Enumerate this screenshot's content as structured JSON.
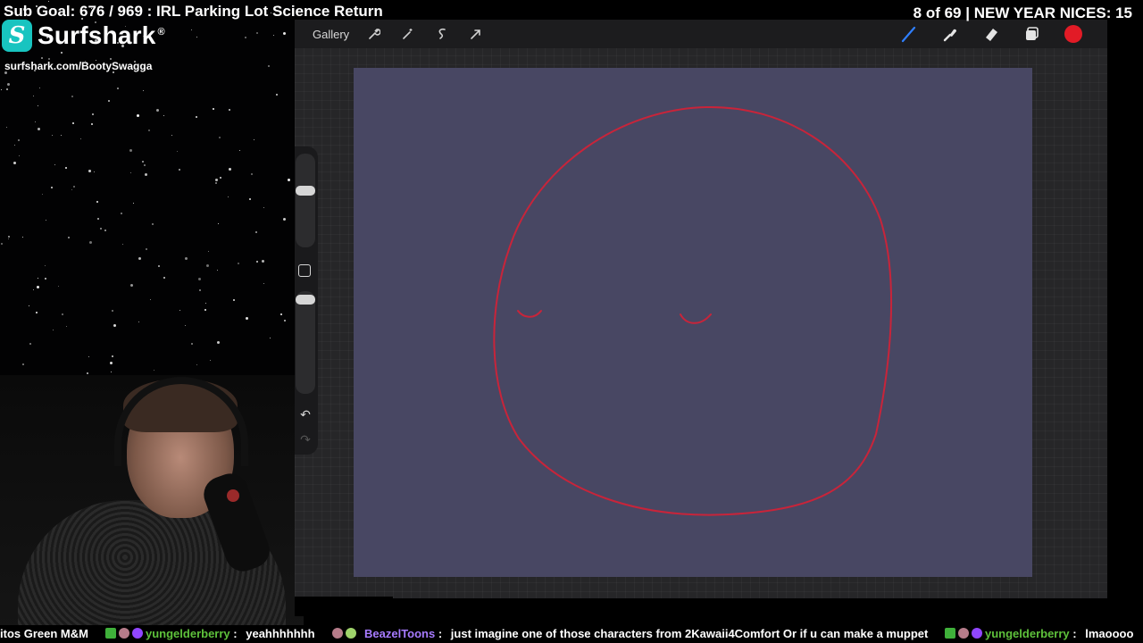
{
  "overlay": {
    "sub_goal": "Sub Goal: 676 / 969 : IRL Parking Lot Science Return",
    "counter": "8 of 69 | NEW YEAR NICES: 15"
  },
  "sponsor": {
    "logo_letter": "S",
    "name": "Surfshark",
    "reg_mark": "®",
    "url": "surfshark.com/BootySwagga",
    "brand_color": "#18c4c0"
  },
  "app": {
    "gallery_label": "Gallery",
    "left_tools": [
      "wrench-icon",
      "magic-wand-icon",
      "selection-icon",
      "transform-icon"
    ],
    "right_tools": [
      "brush-icon",
      "smudge-icon",
      "eraser-icon",
      "layers-icon"
    ],
    "current_color": "#e21b26",
    "canvas_color": "#484763"
  },
  "ticker": {
    "seg1": "itos  Green M&M",
    "seg2_user": "yungelderberry",
    "seg2_sep": " :",
    "seg2_msg": "yeahhhhhhh",
    "seg3_user": "BeazelToons",
    "seg3_sep": " :",
    "seg3_msg": "just imagine one of those characters from 2Kawaii4Comfort  Or if u can make a muppet",
    "seg4_user": "yungelderberry",
    "seg4_sep": " :",
    "seg4_msg": "lmaoooo"
  }
}
